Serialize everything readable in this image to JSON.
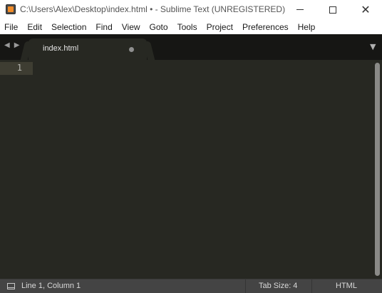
{
  "window": {
    "title": "C:\\Users\\Alex\\Desktop\\index.html • - Sublime Text (UNREGISTERED)",
    "icon": "sublime-text-icon",
    "controls": [
      "minimize-icon",
      "maximize-icon",
      "close-icon"
    ]
  },
  "menu": {
    "items": [
      "File",
      "Edit",
      "Selection",
      "Find",
      "View",
      "Goto",
      "Tools",
      "Project",
      "Preferences",
      "Help"
    ]
  },
  "tabs": {
    "nav_icons": [
      "arrow-left-icon",
      "arrow-right-icon"
    ],
    "active": {
      "label": "index.html",
      "dirty": true
    },
    "dropdown_icon": "chevron-down-icon"
  },
  "editor": {
    "line_numbers": [
      "1"
    ],
    "current_line": 1,
    "background": "#272822"
  },
  "status": {
    "position": "Line 1, Column 1",
    "tab_size": "Tab Size: 4",
    "syntax": "HTML",
    "panel_icon": "panel-icon"
  },
  "colors": {
    "editor_bg": "#272822",
    "tabbar_bg": "#161614",
    "statusbar_bg": "#444444"
  }
}
